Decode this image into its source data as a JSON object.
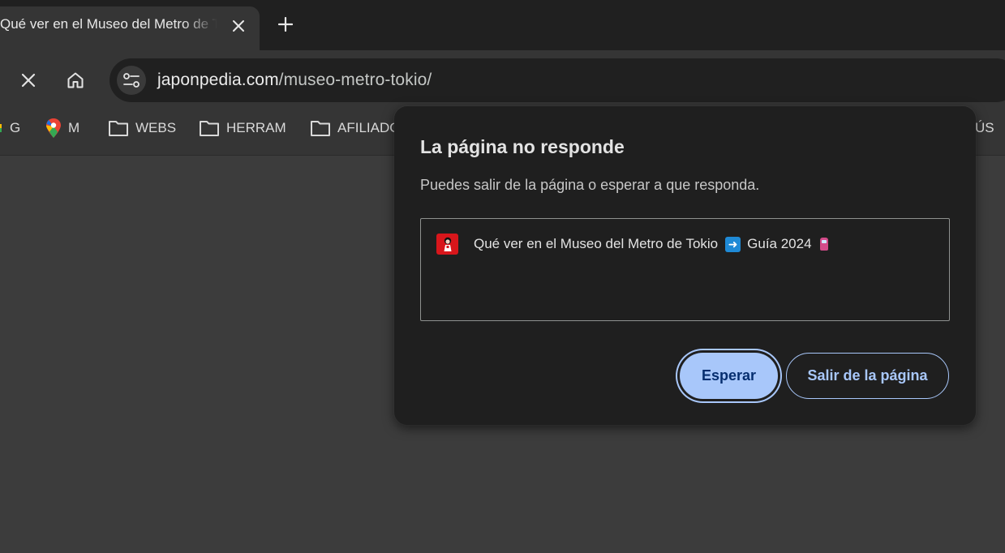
{
  "browser": {
    "tab": {
      "title": "Qué ver en el Museo del Metro de Tokio"
    },
    "toolbar": {
      "url_host": "japonpedia.com",
      "url_path": "/museo-metro-tokio/"
    },
    "bookmarks": [
      {
        "label": "G",
        "icon": "google-icon"
      },
      {
        "label": "M",
        "icon": "maps-pin-icon"
      },
      {
        "label": "WEBS",
        "icon": "folder-icon"
      },
      {
        "label": "HERRAM",
        "icon": "folder-icon"
      },
      {
        "label": "AFILIADOS",
        "icon": "folder-icon"
      },
      {
        "label": "ÚS",
        "icon": "folder-icon"
      }
    ]
  },
  "dialog": {
    "title": "La página no responde",
    "body": "Puedes salir de la página o esperar a que responda.",
    "page": {
      "title_start": "Qué ver en el Museo del Metro de Tokio",
      "title_end": "Guía 2024",
      "arrow_emoji": "➡️",
      "train_emoji": "🚇"
    },
    "wait_label": "Esperar",
    "leave_label": "Salir de la página"
  },
  "colors": {
    "accent": "#a8c7fa",
    "accent_text": "#062e6f",
    "dialog_bg": "#1f1f1f",
    "content_bg": "#3c3c3c"
  }
}
